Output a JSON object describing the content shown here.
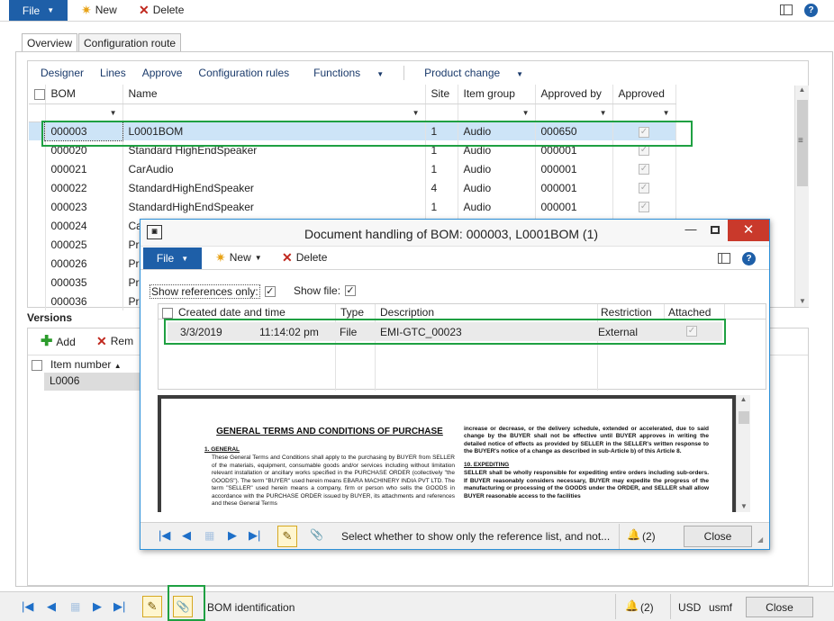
{
  "ribbon": {
    "file_label": "File",
    "new_label": "New",
    "delete_label": "Delete"
  },
  "tabs": {
    "overview": "Overview",
    "configuration_route": "Configuration route"
  },
  "menu": {
    "designer": "Designer",
    "lines": "Lines",
    "approve": "Approve",
    "configuration_rules": "Configuration rules",
    "functions": "Functions",
    "product_change": "Product change"
  },
  "bom_grid": {
    "headers": {
      "bom": "BOM",
      "name": "Name",
      "site": "Site",
      "item_group": "Item group",
      "approved_by": "Approved by",
      "approved": "Approved"
    },
    "rows": [
      {
        "bom": "000003",
        "name": "L0001BOM",
        "site": "1",
        "item_group": "Audio",
        "approved_by": "000650",
        "approved": true
      },
      {
        "bom": "000020",
        "name": "Standard HighEndSpeaker",
        "site": "1",
        "item_group": "Audio",
        "approved_by": "000001",
        "approved": true
      },
      {
        "bom": "000021",
        "name": "CarAudio",
        "site": "1",
        "item_group": "Audio",
        "approved_by": "000001",
        "approved": true
      },
      {
        "bom": "000022",
        "name": "StandardHighEndSpeaker",
        "site": "4",
        "item_group": "Audio",
        "approved_by": "000001",
        "approved": true
      },
      {
        "bom": "000023",
        "name": "StandardHighEndSpeaker",
        "site": "1",
        "item_group": "Audio",
        "approved_by": "000001",
        "approved": true
      },
      {
        "bom": "000024",
        "name": "Ca",
        "site": "",
        "item_group": "",
        "approved_by": "",
        "approved": null
      },
      {
        "bom": "000025",
        "name": "Pr",
        "site": "",
        "item_group": "",
        "approved_by": "",
        "approved": null
      },
      {
        "bom": "000026",
        "name": "Pr",
        "site": "",
        "item_group": "",
        "approved_by": "",
        "approved": null
      },
      {
        "bom": "000035",
        "name": "Pr",
        "site": "",
        "item_group": "",
        "approved_by": "",
        "approved": null
      },
      {
        "bom": "000036",
        "name": "Pr",
        "site": "",
        "item_group": "",
        "approved_by": "",
        "approved": null
      }
    ]
  },
  "versions": {
    "title": "Versions",
    "add_label": "Add",
    "remove_label": "Rem",
    "item_number_header": "Item number",
    "rows": [
      "L0006"
    ]
  },
  "statusbar": {
    "text": "BOM identification",
    "alerts": "(2)",
    "currency": "USD",
    "company": "usmf",
    "close_label": "Close"
  },
  "dialog": {
    "title": "Document handling of BOM: 000003, L0001BOM (1)",
    "file_label": "File",
    "new_label": "New",
    "delete_label": "Delete",
    "show_references_label": "Show references only:",
    "show_file_label": "Show file:",
    "headers": {
      "created": "Created date and time",
      "type": "Type",
      "description": "Description",
      "restriction": "Restriction",
      "attached": "Attached"
    },
    "row": {
      "date": "3/3/2019",
      "time": "11:14:02 pm",
      "type": "File",
      "description": "EMI-GTC_00023",
      "restriction": "External",
      "attached": true
    },
    "doc": {
      "heading": "GENERAL TERMS AND CONDITIONS OF PURCHASE",
      "s1_title": "1. GENERAL",
      "s1_body": "These General Terms and Conditions shall apply to the purchasing by BUYER from SELLER of the materials, equipment, consumable goods and/or services including without limitation relevant installation or ancillary works specified in the PURCHASE ORDER (collectively \"the GOODS\"). The term \"BUYER\" used herein means EBARA MACHINERY INDIA PVT LTD. The term \"SELLER\" used herein means a company, firm or person who sells the GOODS in accordance with the PURCHASE ORDER issued by BUYER, its attachments and references and these General Terms",
      "col2_top": "increase or decrease, or the delivery schedule, extended or accelerated, due to said change by the BUYER shall not be effective until BUYER approves in writing the detailed notice of effects as provided by SELLER in the SELLER's written response to the BUYER's notice of a change as described in sub-Article b) of this Article 8.",
      "s10_title": "10. EXPEDITING",
      "s10_body": "SELLER shall be wholly responsible for expediting entire orders including sub-orders. If BUYER reasonably considers necessary, BUYER may expedite the progress of the manufacturing or processing of the GOODS under the ORDER, and SELLER shall allow BUYER reasonable access to the facilities"
    },
    "status_text": "Select whether to show only the reference list, and not...",
    "alerts": "(2)",
    "close_label": "Close"
  }
}
